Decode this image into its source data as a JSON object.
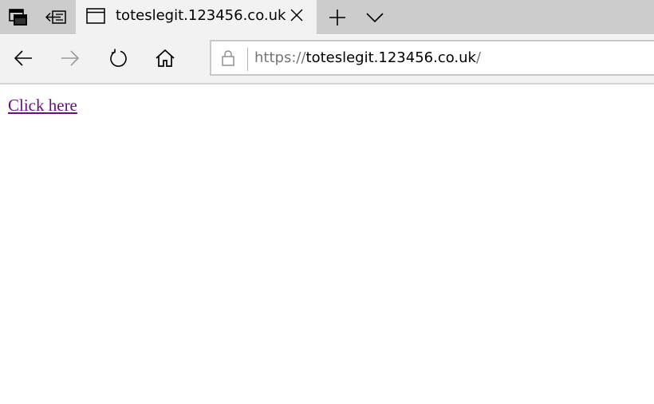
{
  "browser": {
    "tab": {
      "title": "toteslegit.123456.co.uk"
    },
    "tab_buttons": [
      "tabs-aside-icon",
      "set-aside-icon",
      "new-tab-icon",
      "tab-list-icon"
    ],
    "address_bar": {
      "scheme": "https://",
      "host": "toteslegit.123456.co.uk",
      "path": "/"
    },
    "nav_icons": [
      "back-arrow-icon",
      "forward-arrow-icon",
      "refresh-icon",
      "home-icon"
    ]
  },
  "page": {
    "link_text": "Click here"
  },
  "colors": {
    "tabbar": "#cccccc",
    "toolbar": "#f2f2f2",
    "link": "#6a0f81",
    "url_dim": "#767676"
  }
}
